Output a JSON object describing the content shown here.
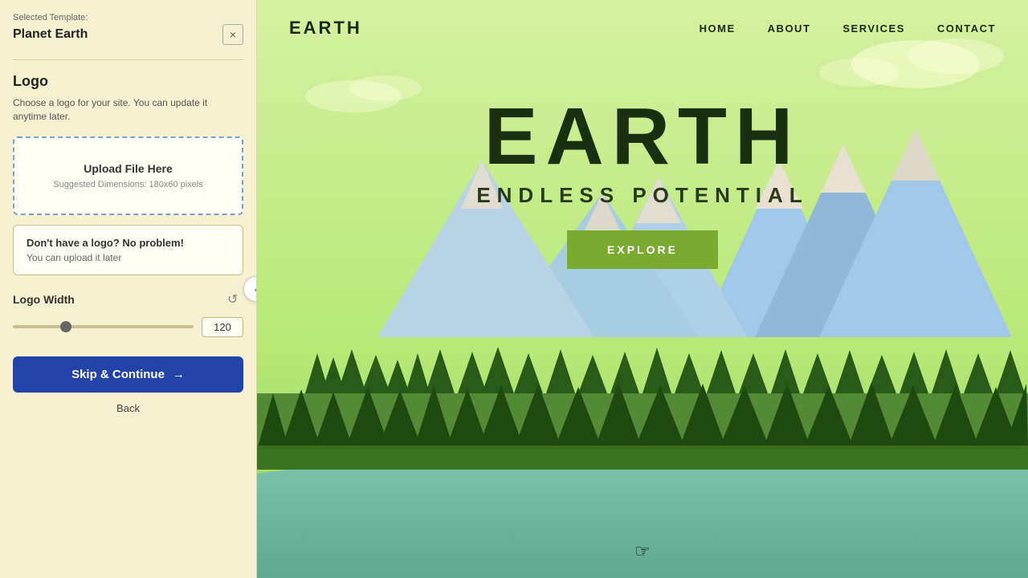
{
  "leftPanel": {
    "selectedTemplateLabel": "Selected Template:",
    "selectedTemplateName": "Planet Earth",
    "closeIcon": "×",
    "logoSection": {
      "title": "Logo",
      "description": "Choose a logo for your site. You can update it anytime later.",
      "uploadBox": {
        "title": "Upload File Here",
        "subtitle": "Suggested Dimensions: 180x60 pixels"
      },
      "noLogoBox": {
        "title": "Don't have a logo? No problem!",
        "subtitle": "You can upload it later"
      }
    },
    "logoWidth": {
      "label": "Logo Width",
      "value": "120",
      "sliderValue": 120
    },
    "skipButton": "Skip & Continue",
    "backLink": "Back",
    "resetIcon": "↺"
  },
  "rightPreview": {
    "nav": {
      "logo": "EARTH",
      "links": [
        "HOME",
        "ABOUT",
        "SERVICES",
        "CONTACT"
      ]
    },
    "hero": {
      "title": "EARTH",
      "subtitle": "ENDLESS POTENTIAL",
      "exploreButton": "EXPLORE"
    }
  },
  "colors": {
    "skipBtn": "#2244aa",
    "exploreBtn": "#7aaa30",
    "panelBg": "#f5f0d0",
    "previewBg": "#c8e0a0"
  }
}
